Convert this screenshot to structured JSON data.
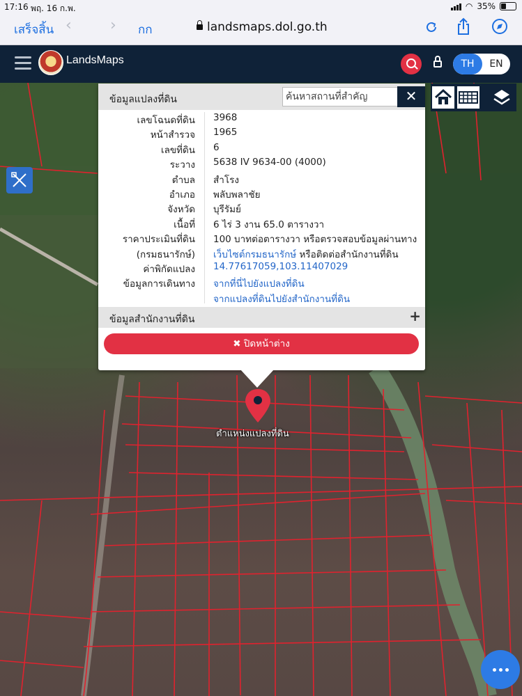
{
  "status_bar": {
    "time": "17:16",
    "date": "พฤ. 16 ก.พ.",
    "battery": "35%"
  },
  "browser": {
    "done_label": "เสร็จสิ้น",
    "aa_label": "กก",
    "url": "landsmaps.dol.go.th"
  },
  "app": {
    "brand": "LandsMaps",
    "lang_th": "TH",
    "lang_en": "EN"
  },
  "popup": {
    "header": "ข้อมูลแปลงที่ดิน",
    "search_placeholder": "ค้นหาสถานที่สำคัญ",
    "search_close": "✕",
    "rows": [
      {
        "label": "เลขโฉนดที่ดิน",
        "value": "3968"
      },
      {
        "label": "หน้าสำรวจ",
        "value": "1965"
      },
      {
        "label": "เลขที่ดิน",
        "value": "6"
      },
      {
        "label": "ระวาง",
        "value": "5638 IV 9634-00 (4000)"
      },
      {
        "label": "ตำบล",
        "value": "สำโรง"
      },
      {
        "label": "อำเภอ",
        "value": "พลับพลาชัย"
      },
      {
        "label": "จังหวัด",
        "value": "บุรีรัมย์"
      },
      {
        "label": "เนื้อที่",
        "value": "6 ไร่ 3 งาน 65.0 ตารางวา"
      },
      {
        "label": "ราคาประเมินที่ดิน",
        "value": "100 บาทต่อตารางวา หรือตรวจสอบข้อมูลผ่านทาง"
      },
      {
        "label": "(กรมธนารักษ์)",
        "value": "เว็บไซต์กรมธนารักษ์",
        "value_suffix": " หรือติดต่อสำนักงานที่ดิน"
      },
      {
        "label": "ค่าพิกัดแปลง",
        "value": "14.77617059,103.11407029"
      },
      {
        "label": "ข้อมูลการเดินทาง",
        "value": "จากที่นี่ไปยังแปลงที่ดิน"
      },
      {
        "label": "",
        "value": "จากแปลงที่ดินไปยังสำนักงานที่ดิน"
      }
    ],
    "office_section": "ข้อมูลสำนักงานที่ดิน",
    "office_expand": "+",
    "close_button": "✖ ปิดหน้าต่าง"
  },
  "map": {
    "pin_label": "ตำแหน่งแปลงที่ดิน"
  },
  "colors": {
    "accent_red": "#e23144",
    "header_navy": "#0f2238",
    "link_blue": "#2366c8",
    "brand_blue": "#2d7be5"
  }
}
